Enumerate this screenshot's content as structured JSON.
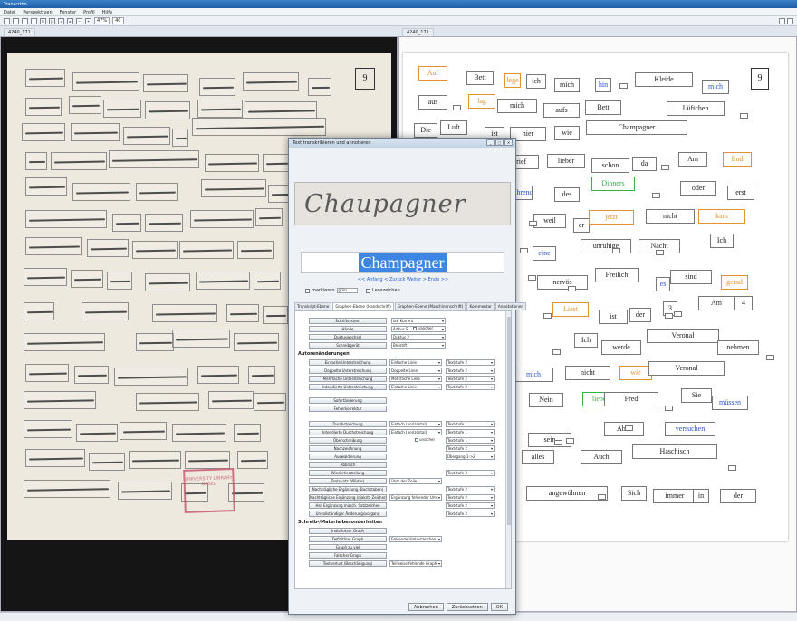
{
  "window": {
    "title": "Transcribo"
  },
  "menu": [
    "Datei",
    "Perspektiven",
    "Fenster",
    "Profil",
    "Hilfe"
  ],
  "toolbar": {
    "zoom": "47%",
    "page": "40"
  },
  "left_tab": "4240_171",
  "right_tab": "4240_171",
  "page_number": "9",
  "stamp_text": "UNIVERSITY LIBRARY BASEL",
  "transcript_words": [
    {
      "t": "Auf",
      "c": "orange"
    },
    {
      "t": "Bett"
    },
    {
      "t": "lege",
      "c": "orange"
    },
    {
      "t": "ich"
    },
    {
      "t": "mich"
    },
    {
      "t": "hin",
      "c": "blue"
    },
    {
      "t": "Kleide"
    },
    {
      "t": "mich",
      "c": "blue"
    },
    {
      "t": "aus"
    },
    {
      "t": "lag",
      "c": "orange"
    },
    {
      "t": "mich"
    },
    {
      "t": "aufs"
    },
    {
      "t": "Bett"
    },
    {
      "t": "Lüftchen"
    },
    {
      "t": "Die"
    },
    {
      "t": "Luft"
    },
    {
      "t": "ist"
    },
    {
      "t": "hier"
    },
    {
      "t": "wie"
    },
    {
      "t": "Champagner"
    },
    {
      "t": "Brief"
    },
    {
      "t": "lieber"
    },
    {
      "t": "schon"
    },
    {
      "t": "da"
    },
    {
      "t": "Am"
    },
    {
      "t": "End",
      "c": "orange"
    },
    {
      "t": "während",
      "c": "blue"
    },
    {
      "t": "des"
    },
    {
      "t": "Dinners",
      "c": "green"
    },
    {
      "t": "oder"
    },
    {
      "t": "erst"
    },
    {
      "t": "weil"
    },
    {
      "t": "er"
    },
    {
      "t": "jetzt",
      "c": "orange"
    },
    {
      "t": "nicht"
    },
    {
      "t": "kam",
      "c": "orange"
    },
    {
      "t": "eine",
      "c": "blue"
    },
    {
      "t": "unruhige"
    },
    {
      "t": "Nacht"
    },
    {
      "t": "Ich"
    },
    {
      "t": "nervös"
    },
    {
      "t": "Freilich"
    },
    {
      "t": "es",
      "c": "blue"
    },
    {
      "t": "sind"
    },
    {
      "t": "gerad",
      "c": "orange"
    },
    {
      "t": "Liest",
      "c": "orange"
    },
    {
      "t": "ist"
    },
    {
      "t": "der"
    },
    {
      "t": "3"
    },
    {
      "t": "Am"
    },
    {
      "t": "4"
    },
    {
      "t": "Ich"
    },
    {
      "t": "werde"
    },
    {
      "t": "Veronal"
    },
    {
      "t": "nehmen"
    },
    {
      "t": "mich",
      "c": "blue"
    },
    {
      "t": "nicht"
    },
    {
      "t": "wie",
      "c": "orange"
    },
    {
      "t": "Veronal"
    },
    {
      "t": "Nein"
    },
    {
      "t": "lieber",
      "c": "green"
    },
    {
      "t": "Fred"
    },
    {
      "t": "Sie"
    },
    {
      "t": "müssen",
      "c": "blue"
    },
    {
      "t": "Aber"
    },
    {
      "t": "sein"
    },
    {
      "t": "versuchen",
      "c": "blue"
    },
    {
      "t": "alles"
    },
    {
      "t": "Auch"
    },
    {
      "t": "Haschisch"
    },
    {
      "t": "angewöhnen"
    },
    {
      "t": "Sich"
    },
    {
      "t": "immer"
    },
    {
      "t": "in"
    },
    {
      "t": "der"
    }
  ],
  "dialog": {
    "title": "Text transkribieren und annotieren",
    "word": "Champagner",
    "nav": "<< Anfang  < Zurück  Weiter >  Ende >>",
    "markieren_label": "markieren",
    "markieren_color": "grün",
    "lesezeichen_label": "Lesezeichen",
    "tabs": [
      "Transkript-Ebene",
      "Graphen-Ebene (Handschrift)",
      "Graphen-Ebene (Maschinenschrift)",
      "Kommentar",
      "Annotationen"
    ],
    "active_tab": 1,
    "basic_rows": [
      {
        "label": "Schriftsystem",
        "value": "lat. Kurrent"
      },
      {
        "label": "Hände",
        "value": "Arthur S.",
        "check": "unsicher"
      },
      {
        "label": "Duktuswechsel",
        "value": "Duktus 2"
      },
      {
        "label": "Schreibgerät",
        "value": "Bleistift"
      }
    ],
    "section1": "Autorenänderungen",
    "rows1": [
      {
        "label": "Einfache Unterstreichung",
        "v1": "Einfache Linie",
        "v2": "Textstufe 2"
      },
      {
        "label": "Doppelte Unterstreichung",
        "v1": "Doppelte Linie",
        "v2": "Textstufe 2"
      },
      {
        "label": "Mehrfache Unterstreichung",
        "v1": "Mehrfache Linie",
        "v2": "Textstufe 2"
      },
      {
        "label": "Intendierte Unterstreichung",
        "v1": "Einfache Linie",
        "v2": "Textstufe 2"
      }
    ],
    "rows2": [
      "Sofortänderung",
      "Fehlerkorrektur"
    ],
    "rows3": [
      {
        "label": "Durchstreichung",
        "v1": "Einfach (horizontal)",
        "v2": "Textstufe 1"
      },
      {
        "label": "Intendierte Durchstreichung",
        "v1": "Einfach (horizontal)",
        "v2": "Textstufe 1"
      },
      {
        "label": "Überschreibung",
        "check": "unsicher",
        "v2": "Textstufe 1"
      },
      {
        "label": "Nachzeichnung",
        "v2": "Textstufe 2"
      },
      {
        "label": "Auswaldierung",
        "v2": "Übergang 1->2"
      },
      {
        "label": "Abbruch"
      },
      {
        "label": "Wiederherstellung",
        "v2": "Textstufe 3"
      },
      {
        "label": "Textsuatz (Wörter)",
        "v1": "über der Zeile"
      },
      {
        "label": "Nachträgliche Ergänzung (Buchstaben)",
        "v2": "Textstufe 2"
      },
      {
        "label": "Nachträgliche Ergänzung (diakrit. Zeichen)",
        "v1": "Ergänzung fehlender Umt.",
        "v2": "Textstufe 2"
      },
      {
        "label": "Hsl. Ergänzung masch. Satzzeichen",
        "v2": "Textstufe 2"
      },
      {
        "label": "Unvollständiger Änderungsvorgang",
        "v2": "Textstufe 2"
      }
    ],
    "section2": "Schreib-/Materialbesonderheiten",
    "rows4": [
      {
        "label": "Indistinkter Graph"
      },
      {
        "label": "Defizitärer Graph",
        "v1": "Fehlende Umlautzeichen"
      },
      {
        "label": "Graph zu viel"
      },
      {
        "label": "Falscher Graph"
      },
      {
        "label": "Textverlust (Beschädigung)",
        "v1": "Teilweise fehlende Graph"
      }
    ],
    "buttons": [
      "Abbrechen",
      "Zurücksetzen",
      "OK"
    ]
  }
}
